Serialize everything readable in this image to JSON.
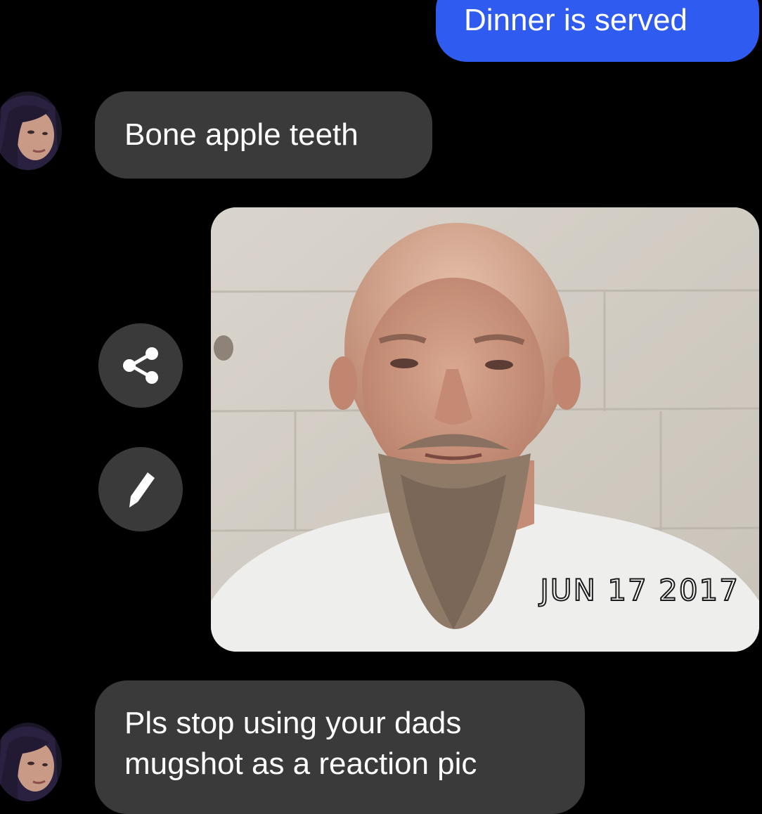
{
  "conversation": {
    "messages": [
      {
        "sender": "me",
        "type": "text",
        "text": "Dinner is served"
      },
      {
        "sender": "friend",
        "type": "text",
        "text": "Bone apple teeth"
      },
      {
        "sender": "friend",
        "type": "image",
        "stamp": "JUN 17 2017"
      },
      {
        "sender": "friend",
        "type": "text",
        "text": "Pls stop using your dads mugshot as a reaction pic"
      }
    ]
  },
  "actions": [
    {
      "icon": "share-icon"
    },
    {
      "icon": "pencil-icon"
    }
  ],
  "colors": {
    "background": "#000000",
    "sent_bubble": "#2f5bf0",
    "received_bubble": "#3a3a3a",
    "text": "#ffffff"
  }
}
